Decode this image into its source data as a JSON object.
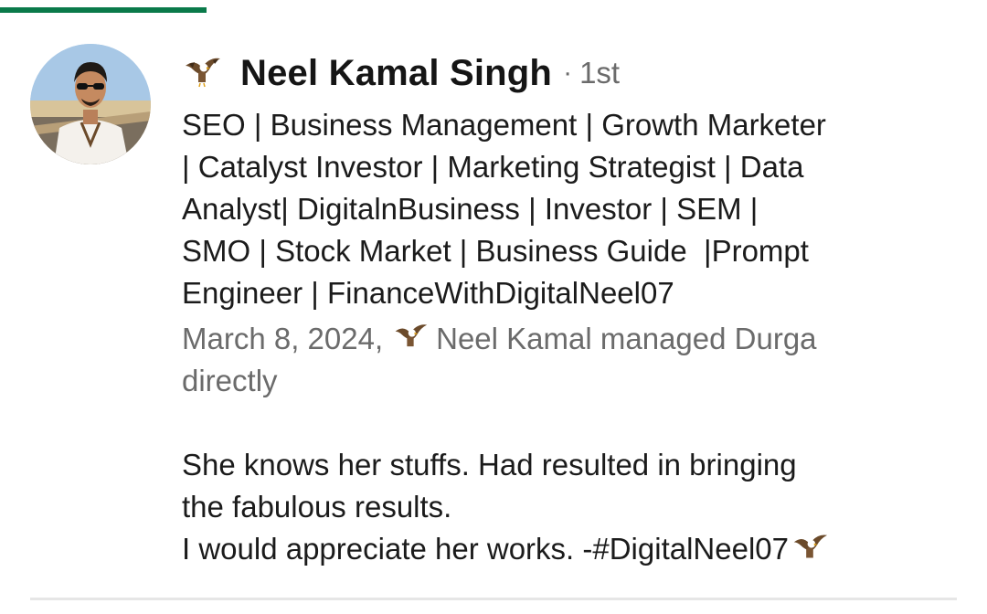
{
  "recommendation": {
    "author": {
      "name": "Neel Kamal Singh",
      "separator": "·",
      "degree": "1st",
      "avatar_icon": "profile-photo",
      "name_emoji_icon": "eagle-icon",
      "headline_lines": [
        "SEO | Business Management | Growth Marketer",
        "| Catalyst Investor | Marketing Strategist | Data",
        "Analyst| DigitalnBusiness | Investor | SEM |",
        "SMO | Stock Market | Business Guide  |Prompt",
        "Engineer | FinanceWithDigitalNeel07"
      ]
    },
    "meta": {
      "date": "March 8, 2024,",
      "relationship": "Neel Kamal managed Durga",
      "relationship_line2": "directly"
    },
    "body": {
      "lines": [
        "She knows her stuffs. Had resulted in bringing",
        "the fabulous results.",
        "I would appreciate her works. -#DigitalNeel07"
      ]
    }
  },
  "colors": {
    "accent_green": "#0a7a4a",
    "primary_text": "#1b1b1b",
    "secondary_text": "#6b6b6b",
    "divider": "#e6e6e6"
  }
}
